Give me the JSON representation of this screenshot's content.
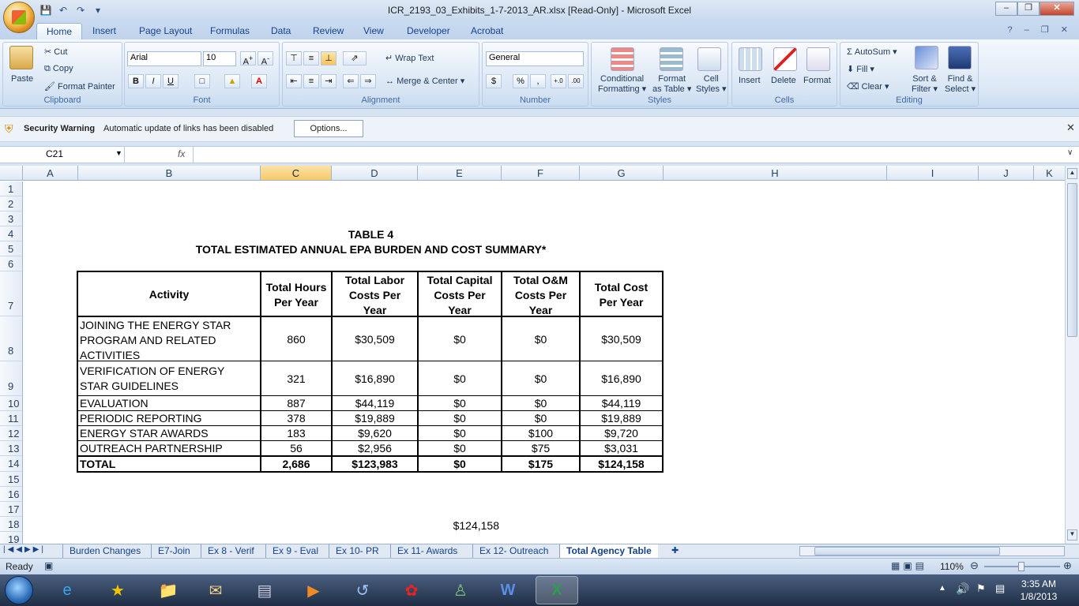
{
  "window": {
    "title": "ICR_2193_03_Exhibits_1-7-2013_AR.xlsx  [Read-Only] - Microsoft Excel"
  },
  "tabs": [
    "Home",
    "Insert",
    "Page Layout",
    "Formulas",
    "Data",
    "Review",
    "View",
    "Developer",
    "Acrobat"
  ],
  "ribbon": {
    "clipboard": {
      "paste": "Paste",
      "cut": "Cut",
      "copy": "Copy",
      "format_painter": "Format Painter",
      "label": "Clipboard"
    },
    "font": {
      "name": "Arial",
      "size": "10",
      "bold": "B",
      "italic": "I",
      "underline": "U",
      "label": "Font"
    },
    "alignment": {
      "wrap": "Wrap Text",
      "merge": "Merge & Center",
      "label": "Alignment"
    },
    "number": {
      "format": "General",
      "dollar": "$",
      "percent": "%",
      "comma": ",",
      "inc": ".0→.00",
      "dec": ".00→.0",
      "label": "Number"
    },
    "styles": {
      "cond1": "Conditional",
      "cond2": "Formatting",
      "fmt1": "Format",
      "fmt2": "as Table",
      "cell1": "Cell",
      "cell2": "Styles",
      "label": "Styles"
    },
    "cells": {
      "insert": "Insert",
      "delete": "Delete",
      "format": "Format",
      "label": "Cells"
    },
    "editing": {
      "autosum": "AutoSum",
      "fill": "Fill",
      "clear": "Clear",
      "sort1": "Sort &",
      "sort2": "Filter",
      "find1": "Find &",
      "find2": "Select",
      "label": "Editing"
    }
  },
  "security": {
    "title": "Security Warning",
    "message": "Automatic update of links has been disabled",
    "button": "Options..."
  },
  "formula_bar": {
    "namebox": "C21",
    "fx": "fx",
    "value": ""
  },
  "columns": [
    "A",
    "B",
    "C",
    "D",
    "E",
    "F",
    "G",
    "H",
    "I",
    "J",
    "K"
  ],
  "rows": [
    "1",
    "2",
    "3",
    "4",
    "5",
    "6",
    "7",
    "8",
    "9",
    "10",
    "11",
    "12",
    "13",
    "14",
    "15",
    "16",
    "17",
    "18",
    "19"
  ],
  "sheet": {
    "title1": "TABLE 4",
    "title2": "TOTAL ESTIMATED ANNUAL EPA BURDEN AND COST SUMMARY*",
    "headers": {
      "activity": "Activity",
      "hours": [
        "Total Hours",
        "Per Year"
      ],
      "labor": [
        "Total Labor",
        "Costs Per",
        "Year"
      ],
      "capital": [
        "Total Capital",
        "Costs Per",
        "Year"
      ],
      "om": [
        "Total O&M",
        "Costs Per",
        "Year"
      ],
      "total": [
        "Total Cost",
        "Per Year"
      ]
    },
    "rows": [
      {
        "activity": [
          "JOINING THE ENERGY STAR",
          "PROGRAM AND RELATED",
          "ACTIVITIES"
        ],
        "hours": "860",
        "labor": "$30,509",
        "capital": "$0",
        "om": "$0",
        "total": "$30,509"
      },
      {
        "activity": [
          "VERIFICATION OF ENERGY",
          "STAR GUIDELINES"
        ],
        "hours": "321",
        "labor": "$16,890",
        "capital": "$0",
        "om": "$0",
        "total": "$16,890"
      },
      {
        "activity": [
          "EVALUATION"
        ],
        "hours": "887",
        "labor": "$44,119",
        "capital": "$0",
        "om": "$0",
        "total": "$44,119"
      },
      {
        "activity": [
          "PERIODIC REPORTING"
        ],
        "hours": "378",
        "labor": "$19,889",
        "capital": "$0",
        "om": "$0",
        "total": "$19,889"
      },
      {
        "activity": [
          "ENERGY STAR AWARDS"
        ],
        "hours": "183",
        "labor": "$9,620",
        "capital": "$0",
        "om": "$100",
        "total": "$9,720"
      },
      {
        "activity": [
          "OUTREACH PARTNERSHIP"
        ],
        "hours": "56",
        "labor": "$2,956",
        "capital": "$0",
        "om": "$75",
        "total": "$3,031"
      }
    ],
    "total_row": {
      "activity": "TOTAL",
      "hours": "2,686",
      "labor": "$123,983",
      "capital": "$0",
      "om": "$175",
      "total": "$124,158"
    },
    "e18": "$124,158"
  },
  "sheet_tabs": [
    "Burden Changes",
    "E7-Join",
    "Ex 8 - Verif",
    "Ex 9 - Eval",
    "Ex 10- PR",
    "Ex 11- Awards",
    "Ex 12- Outreach",
    "Total Agency Table"
  ],
  "active_sheet": "Total Agency Table",
  "status": {
    "ready": "Ready",
    "zoom": "110%"
  },
  "taskbar": {
    "time": "3:35 AM",
    "date": "1/8/2013"
  }
}
